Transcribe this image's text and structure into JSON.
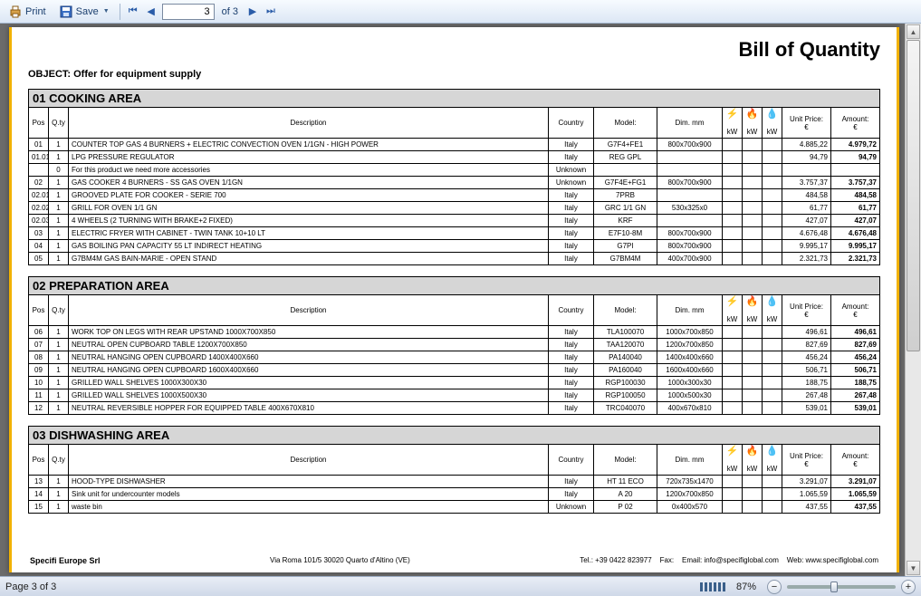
{
  "toolbar": {
    "print": "Print",
    "save": "Save",
    "page_current": "3",
    "page_total": "of 3"
  },
  "status": {
    "page_text": "Page 3 of 3",
    "zoom_pct": "87%"
  },
  "doc": {
    "title": "Bill of Quantity",
    "object_label": "OBJECT: Offer for equipment supply",
    "footer": {
      "company": "Specifi Europe Srl",
      "address": "Via Roma 101/5 30020 Quarto d'Altino (VE)",
      "tel": "Tel.: +39 0422 823977",
      "fax": "Fax:",
      "email": "Email: info@specifiglobal.com",
      "web": "Web: www.specifiglobal.com"
    },
    "columns": {
      "pos": "Pos",
      "qty": "Q.ty",
      "desc": "Description",
      "country": "Country",
      "model": "Model:",
      "dim": "Dim. mm",
      "kw_e": "kW",
      "kw_g": "kW",
      "kw_w": "kW",
      "unit_price": "Unit Price: €",
      "amount": "Amount: €"
    },
    "icons": {
      "elec": "⚡",
      "gas": "🔥",
      "water": "💧"
    },
    "sections": [
      {
        "title": "01 COOKING AREA",
        "rows": [
          {
            "pos": "01",
            "qty": "1",
            "desc": "COUNTER TOP GAS 4 BURNERS + ELECTRIC CONVECTION OVEN 1/1GN - HIGH POWER",
            "country": "Italy",
            "model": "G7F4+FE1",
            "dim": "800x700x900",
            "kw_e": "",
            "kw_g": "",
            "kw_w": "",
            "price": "4.885,22",
            "amount": "4.979,72"
          },
          {
            "pos": "01.01",
            "qty": "1",
            "desc": "LPG PRESSURE REGULATOR",
            "country": "Italy",
            "model": "REG GPL",
            "dim": "",
            "kw_e": "",
            "kw_g": "",
            "kw_w": "",
            "price": "94,79",
            "amount": "94,79"
          },
          {
            "pos": "",
            "qty": "0",
            "desc": "For this product we need more accessories",
            "country": "Unknown",
            "model": "",
            "dim": "",
            "kw_e": "",
            "kw_g": "",
            "kw_w": "",
            "price": "",
            "amount": ""
          },
          {
            "pos": "02",
            "qty": "1",
            "desc": "GAS COOKER 4 BURNERS - SS GAS OVEN 1/1GN",
            "country": "Unknown",
            "model": "G7F4E+FG1",
            "dim": "800x700x900",
            "kw_e": "",
            "kw_g": "",
            "kw_w": "",
            "price": "3.757,37",
            "amount": "3.757,37"
          },
          {
            "pos": "02.01",
            "qty": "1",
            "desc": "GROOVED PLATE FOR COOKER - SERIE 700",
            "country": "Italy",
            "model": "7PRB",
            "dim": "",
            "kw_e": "",
            "kw_g": "",
            "kw_w": "",
            "price": "484,58",
            "amount": "484,58"
          },
          {
            "pos": "02.02",
            "qty": "1",
            "desc": "GRILL FOR OVEN 1/1 GN",
            "country": "Italy",
            "model": "GRC 1/1 GN",
            "dim": "530x325x0",
            "kw_e": "",
            "kw_g": "",
            "kw_w": "",
            "price": "61,77",
            "amount": "61,77"
          },
          {
            "pos": "02.03",
            "qty": "1",
            "desc": "4 WHEELS (2 TURNING WITH BRAKE+2 FIXED)",
            "country": "Italy",
            "model": "KRF",
            "dim": "",
            "kw_e": "",
            "kw_g": "",
            "kw_w": "",
            "price": "427,07",
            "amount": "427,07"
          },
          {
            "pos": "03",
            "qty": "1",
            "desc": "ELECTRIC FRYER WITH CABINET - TWIN TANK 10+10 LT",
            "country": "Italy",
            "model": "E7F10-8M",
            "dim": "800x700x900",
            "kw_e": "",
            "kw_g": "",
            "kw_w": "",
            "price": "4.676,48",
            "amount": "4.676,48"
          },
          {
            "pos": "04",
            "qty": "1",
            "desc": "GAS BOILING PAN CAPACITY 55 LT INDIRECT HEATING",
            "country": "Italy",
            "model": "G7PI",
            "dim": "800x700x900",
            "kw_e": "",
            "kw_g": "",
            "kw_w": "",
            "price": "9.995,17",
            "amount": "9.995,17"
          },
          {
            "pos": "05",
            "qty": "1",
            "desc": "G7BM4M GAS BAIN-MARIE - OPEN STAND",
            "country": "Italy",
            "model": "G7BM4M",
            "dim": "400x700x900",
            "kw_e": "",
            "kw_g": "",
            "kw_w": "",
            "price": "2.321,73",
            "amount": "2.321,73"
          }
        ]
      },
      {
        "title": "02 PREPARATION AREA",
        "rows": [
          {
            "pos": "06",
            "qty": "1",
            "desc": "WORK TOP ON LEGS WITH REAR UPSTAND 1000X700X850",
            "country": "Italy",
            "model": "TLA100070",
            "dim": "1000x700x850",
            "kw_e": "",
            "kw_g": "",
            "kw_w": "",
            "price": "496,61",
            "amount": "496,61"
          },
          {
            "pos": "07",
            "qty": "1",
            "desc": "NEUTRAL OPEN CUPBOARD TABLE 1200X700X850",
            "country": "Italy",
            "model": "TAA120070",
            "dim": "1200x700x850",
            "kw_e": "",
            "kw_g": "",
            "kw_w": "",
            "price": "827,69",
            "amount": "827,69"
          },
          {
            "pos": "08",
            "qty": "1",
            "desc": "NEUTRAL HANGING OPEN CUPBOARD 1400X400X660",
            "country": "Italy",
            "model": "PA140040",
            "dim": "1400x400x660",
            "kw_e": "",
            "kw_g": "",
            "kw_w": "",
            "price": "456,24",
            "amount": "456,24"
          },
          {
            "pos": "09",
            "qty": "1",
            "desc": "NEUTRAL HANGING OPEN CUPBOARD 1600X400X660",
            "country": "Italy",
            "model": "PA160040",
            "dim": "1600x400x660",
            "kw_e": "",
            "kw_g": "",
            "kw_w": "",
            "price": "506,71",
            "amount": "506,71"
          },
          {
            "pos": "10",
            "qty": "1",
            "desc": "GRILLED WALL SHELVES 1000X300X30",
            "country": "Italy",
            "model": "RGP100030",
            "dim": "1000x300x30",
            "kw_e": "",
            "kw_g": "",
            "kw_w": "",
            "price": "188,75",
            "amount": "188,75"
          },
          {
            "pos": "11",
            "qty": "1",
            "desc": "GRILLED WALL SHELVES 1000X500X30",
            "country": "Italy",
            "model": "RGP100050",
            "dim": "1000x500x30",
            "kw_e": "",
            "kw_g": "",
            "kw_w": "",
            "price": "267,48",
            "amount": "267,48"
          },
          {
            "pos": "12",
            "qty": "1",
            "desc": "NEUTRAL REVERSIBLE HOPPER FOR EQUIPPED TABLE 400X670X810",
            "country": "Italy",
            "model": "TRC040070",
            "dim": "400x670x810",
            "kw_e": "",
            "kw_g": "",
            "kw_w": "",
            "price": "539,01",
            "amount": "539,01"
          }
        ]
      },
      {
        "title": "03 DISHWASHING AREA",
        "rows": [
          {
            "pos": "13",
            "qty": "1",
            "desc": "HOOD-TYPE DISHWASHER",
            "country": "Italy",
            "model": "HT 11 ECO",
            "dim": "720x735x1470",
            "kw_e": "",
            "kw_g": "",
            "kw_w": "",
            "price": "3.291,07",
            "amount": "3.291,07"
          },
          {
            "pos": "14",
            "qty": "1",
            "desc": "Sink unit for undercounter models",
            "country": "Italy",
            "model": "A 20",
            "dim": "1200x700x850",
            "kw_e": "",
            "kw_g": "",
            "kw_w": "",
            "price": "1.065,59",
            "amount": "1.065,59"
          },
          {
            "pos": "15",
            "qty": "1",
            "desc": "waste bin",
            "country": "Unknown",
            "model": "P 02",
            "dim": "0x400x570",
            "kw_e": "",
            "kw_g": "",
            "kw_w": "",
            "price": "437,55",
            "amount": "437,55"
          }
        ]
      }
    ]
  }
}
